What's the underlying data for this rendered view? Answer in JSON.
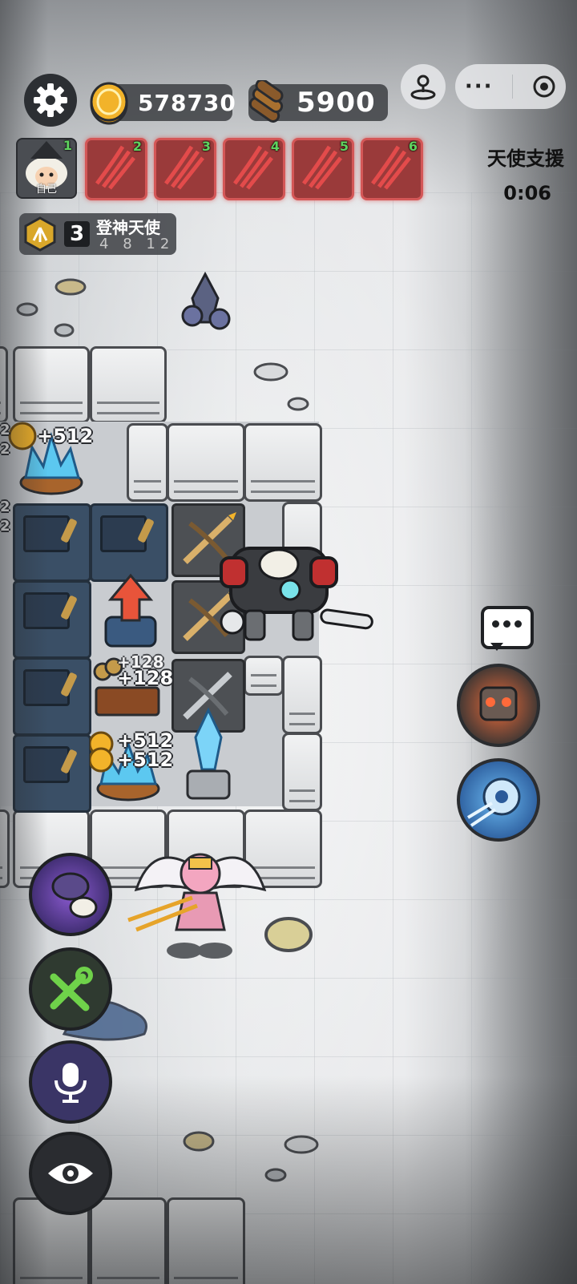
{
  "hud": {
    "settings_icon": "gear-icon",
    "gold": "578730",
    "wood": "5900",
    "colors": {
      "gold": "#f2b32a",
      "wood": "#8a5a2b",
      "enemy_border": "#d45757"
    }
  },
  "players": {
    "self": {
      "number": "1",
      "label": "自己"
    },
    "enemies": [
      {
        "number": "2"
      },
      {
        "number": "3"
      },
      {
        "number": "4"
      },
      {
        "number": "5"
      },
      {
        "number": "6"
      }
    ]
  },
  "support": {
    "title": "天使支援",
    "timer": "0:06"
  },
  "bond": {
    "count": "3",
    "name": "登神天使",
    "levels": [
      "4",
      "8",
      "12"
    ]
  },
  "board": {
    "gains": [
      "+512",
      "+128",
      "+128",
      "+512",
      "+512"
    ],
    "edge_digits": [
      "2",
      "2",
      "2",
      "2"
    ]
  },
  "side_buttons": [
    "chat-icon",
    "robot-skill-icon",
    "saw-blade-skill-icon"
  ],
  "left_buttons": [
    "wolf-sheep-skill-icon",
    "build-tools-icon",
    "microphone-icon",
    "eye-icon"
  ]
}
